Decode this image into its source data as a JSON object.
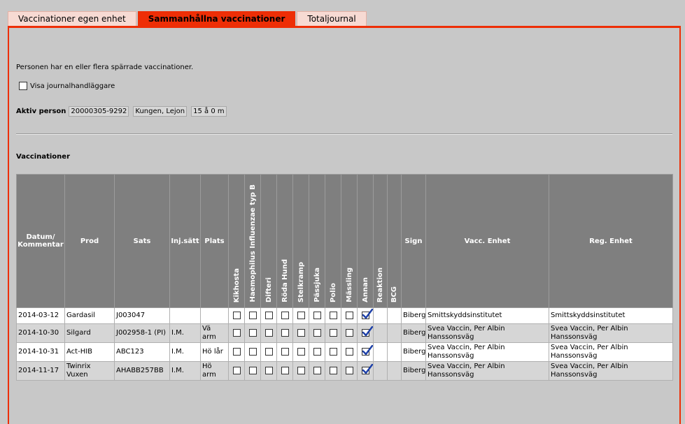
{
  "tabs": [
    {
      "label": "Vaccinationer egen enhet",
      "active": false
    },
    {
      "label": "Sammanhållna vaccinationer",
      "active": true
    },
    {
      "label": "Totaljournal",
      "active": false
    }
  ],
  "notice": "Personen har en eller flera spärrade vaccinationer.",
  "show_handler_label": "Visa journalhandläggare",
  "person": {
    "label": "Aktiv person",
    "id": "20000305-9292",
    "name": "Kungen, Lejon",
    "age": "15 å 0 m"
  },
  "section_title": "Vaccinationer",
  "accent_color": "#ee2e06",
  "table": {
    "headers": {
      "date": "Datum/ Kommentar",
      "prod": "Prod",
      "sats": "Sats",
      "inj": "Inj.sätt",
      "plats": "Plats",
      "kikhosta": "Kikhosta",
      "hib": "Haemophilus Influenzae typ B",
      "difteri": "Difteri",
      "roda_hund": "Röda Hund",
      "stelkramp": "Stelkramp",
      "passjuka": "Pässjuka",
      "polio": "Polio",
      "massling": "Mässling",
      "annan": "Annan",
      "reaktion": "Reaktion",
      "bcg": "BCG",
      "sign": "Sign",
      "vacc_enhet": "Vacc. Enhet",
      "reg_enhet": "Reg. Enhet"
    },
    "rows": [
      {
        "date": "2014-03-12",
        "prod": "Gardasil",
        "sats": "J003047",
        "inj": "",
        "plats": "",
        "annan_checked": true,
        "sign": "Biberg",
        "vacc_enhet": "Smittskyddsinstitutet",
        "reg_enhet": "Smittskyddsinstitutet"
      },
      {
        "date": "2014-10-30",
        "prod": "Silgard",
        "sats": "J002958-1 (PI)",
        "inj": "I.M.",
        "plats": "Vä arm",
        "annan_checked": true,
        "sign": "Biberg",
        "vacc_enhet": "Svea Vaccin, Per Albin Hanssonsväg",
        "reg_enhet": "Svea Vaccin, Per Albin Hanssonsväg"
      },
      {
        "date": "2014-10-31",
        "prod": "Act-HIB",
        "sats": "ABC123",
        "inj": "I.M.",
        "plats": "Hö lår",
        "annan_checked": true,
        "sign": "Biberg",
        "vacc_enhet": "Svea Vaccin, Per Albin Hanssonsväg",
        "reg_enhet": "Svea Vaccin, Per Albin Hanssonsväg"
      },
      {
        "date": "2014-11-17",
        "prod": "Twinrix Vuxen",
        "sats": "AHABB257BB",
        "inj": "I.M.",
        "plats": "Hö arm",
        "annan_checked": true,
        "sign": "Biberg",
        "vacc_enhet": "Svea Vaccin, Per Albin Hanssonsväg",
        "reg_enhet": "Svea Vaccin, Per Albin Hanssonsväg"
      }
    ]
  }
}
